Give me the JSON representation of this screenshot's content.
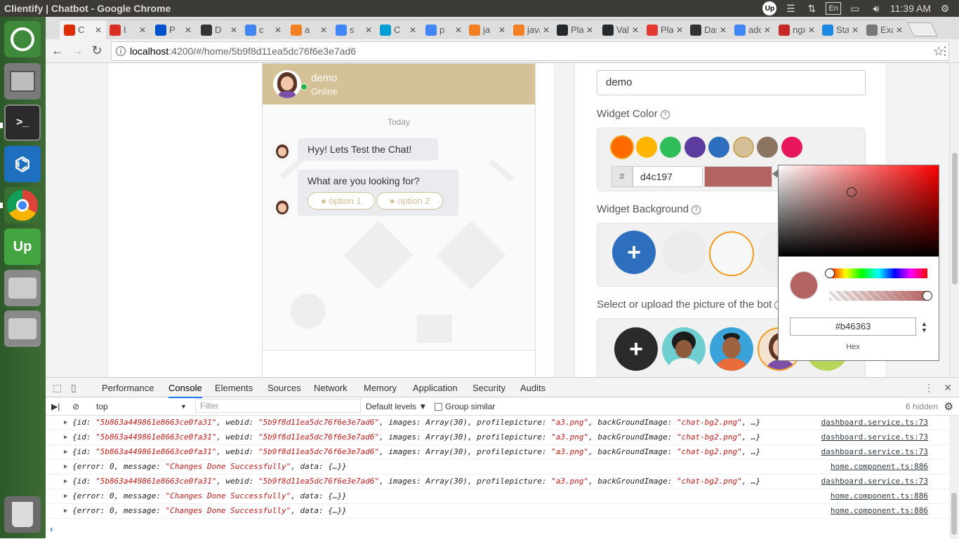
{
  "window": {
    "title": "Clientify | Chatbot - Google Chrome",
    "time": "11:39 AM",
    "language": "En"
  },
  "tabs": [
    {
      "label": "C",
      "color": "#dd2c00"
    },
    {
      "label": "I",
      "color": "#d93025"
    },
    {
      "label": "P",
      "color": "#0052cc"
    },
    {
      "label": "D",
      "color": "#333333"
    },
    {
      "label": "c",
      "color": "#4285f4"
    },
    {
      "label": "a",
      "color": "#f48024"
    },
    {
      "label": "s",
      "color": "#4285f4"
    },
    {
      "label": "C",
      "color": "#00a0d6"
    },
    {
      "label": "p",
      "color": "#4285f4"
    },
    {
      "label": "ja",
      "color": "#f48024"
    },
    {
      "label": "java",
      "color": "#f48024"
    },
    {
      "label": "Pla",
      "color": "#24292e"
    },
    {
      "label": "Val",
      "color": "#24292e"
    },
    {
      "label": "Pla",
      "color": "#e53935"
    },
    {
      "label": "Das",
      "color": "#333333"
    },
    {
      "label": "adc",
      "color": "#4285f4"
    },
    {
      "label": "ngx",
      "color": "#c62828"
    },
    {
      "label": "Sta",
      "color": "#1e88e5"
    },
    {
      "label": "Exa",
      "color": "#777777"
    }
  ],
  "address": {
    "host": "localhost",
    "path": ":4200/#/home/5b9f8d11ea5dc76f6e3e7ad6"
  },
  "chat": {
    "name": "demo",
    "status": "Online",
    "day": "Today",
    "message1": "Hyy! Lets Test the Chat!",
    "message2": "What are you looking for?",
    "option1": "● option 1",
    "option2": "● option 2",
    "accent": "#d4c197"
  },
  "settings": {
    "name_value": "demo",
    "widget_color_label": "Widget Color",
    "swatches": [
      "#ff6a00",
      "#ffb400",
      "#2ebd59",
      "#5b3c9e",
      "#2d6ebf",
      "#d4c197",
      "#8b7462",
      "#e8175d"
    ],
    "hash": "#",
    "color_hex": "d4c197",
    "widget_background_label": "Widget Background",
    "picture_label": "Select or upload the picture of the bot",
    "plus": "+"
  },
  "picker": {
    "hex_value": "#b46363",
    "hex_label": "Hex",
    "color": "#b46363"
  },
  "devtools": {
    "tabs": [
      "Performance",
      "Console",
      "Elements",
      "Sources",
      "Network",
      "Memory",
      "Application",
      "Security",
      "Audits"
    ],
    "context": "top",
    "filter_placeholder": "Filter",
    "levels": "Default levels ▼",
    "group_similar": "Group similar",
    "hidden": "6 hidden",
    "logs": [
      {
        "text": "{id: \"5b863a449861e8663ce0fa31\", webid: \"5b9f8d11ea5dc76f6e3e7ad6\", images: Array(30), profilepicture: \"a3.png\", backGroundImage: \"chat-bg2.png\", …}",
        "src": "dashboard.service.ts:73"
      },
      {
        "text": "{id: \"5b863a449861e8663ce0fa31\", webid: \"5b9f8d11ea5dc76f6e3e7ad6\", images: Array(30), profilepicture: \"a3.png\", backGroundImage: \"chat-bg2.png\", …}",
        "src": "dashboard.service.ts:73"
      },
      {
        "text": "{id: \"5b863a449861e8663ce0fa31\", webid: \"5b9f8d11ea5dc76f6e3e7ad6\", images: Array(30), profilepicture: \"a3.png\", backGroundImage: \"chat-bg2.png\", …}",
        "src": "dashboard.service.ts:73"
      },
      {
        "text": "{error: 0, message: \"Changes Done Successfully\", data: {…}}",
        "src": "home.component.ts:886"
      },
      {
        "text": "{id: \"5b863a449861e8663ce0fa31\", webid: \"5b9f8d11ea5dc76f6e3e7ad6\", images: Array(30), profilepicture: \"a3.png\", backGroundImage: \"chat-bg2.png\", …}",
        "src": "dashboard.service.ts:73"
      },
      {
        "text": "{error: 0, message: \"Changes Done Successfully\", data: {…}}",
        "src": "home.component.ts:886"
      },
      {
        "text": "{error: 0, message: \"Changes Done Successfully\", data: {…}}",
        "src": "home.component.ts:886"
      }
    ]
  }
}
